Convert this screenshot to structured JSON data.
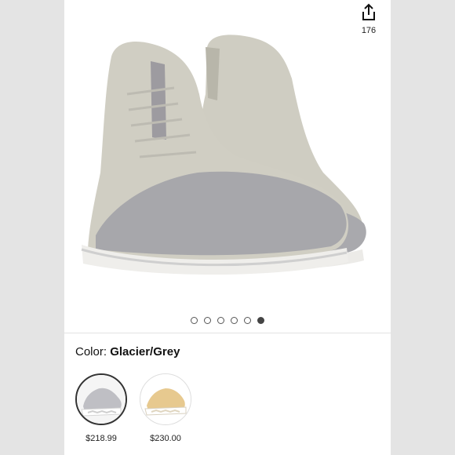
{
  "share": {
    "icon": "share-icon",
    "count": "176"
  },
  "carousel": {
    "total": 6,
    "active_index": 5
  },
  "color": {
    "label": "Color:",
    "value": "Glacier/Grey"
  },
  "variants": [
    {
      "name": "Glacier/Grey",
      "price": "$218.99",
      "selected": true,
      "tone": "#bfbfc4"
    },
    {
      "name": "tan variant",
      "price": "$230.00",
      "selected": false,
      "tone": "#e7c98f"
    }
  ],
  "colors": {
    "background": "#e6e6e6",
    "panel": "#ffffff",
    "accent": "#333333"
  }
}
